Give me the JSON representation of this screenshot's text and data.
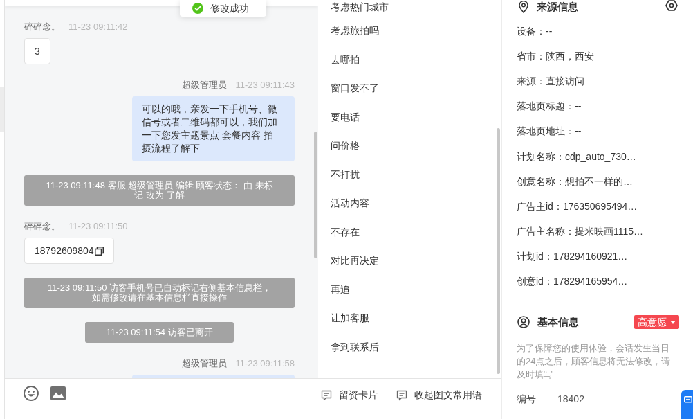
{
  "toast": {
    "kind": "success",
    "text": "修改成功"
  },
  "chat": {
    "messages": [
      {
        "kind": "visitor",
        "sender": "碎碎念。",
        "time": "11-23 09:11:42",
        "text": "3",
        "copyable": false
      },
      {
        "kind": "agent",
        "sender": "超级管理员",
        "time": "11-23 09:11:43",
        "text": "可以的哦，亲发一下手机号、微信号或者二维码都可以，我们加一下您发主题景点 套餐内容 拍摄流程了解下"
      },
      {
        "kind": "system",
        "text": "11-23 09:11:48 客服 超级管理员 编辑 顾客状态： 由 未标记 改为 了解"
      },
      {
        "kind": "visitor",
        "sender": "碎碎念。",
        "time": "11-23 09:11:50",
        "text": "18792609804",
        "copyable": true
      },
      {
        "kind": "system",
        "text": "11-23 09:11:50 访客手机号已自动标记右侧基本信息栏，如需修改请在基本信息栏直接操作"
      },
      {
        "kind": "system",
        "text": "11-23 09:11:54 访客已离开"
      },
      {
        "kind": "agent",
        "sender": "超级管理员",
        "time": "11-23 09:11:58"
      }
    ]
  },
  "input_toolbar": {
    "actions": [
      {
        "label": "留资卡片"
      },
      {
        "label": "收起图文常用语"
      }
    ]
  },
  "quick_replies": {
    "items": [
      "考虑热门城市",
      "考虑旅拍吗",
      "去哪拍",
      "窗口发不了",
      "要电话",
      "问价格",
      "不打扰",
      "活动内容",
      "不存在",
      "对比再决定",
      "再追",
      "让加客服",
      "拿到联系后"
    ]
  },
  "source_info": {
    "title": "来源信息",
    "fields": [
      "设备：--",
      "省市：陕西，西安",
      "来源：直接访问",
      "落地页标题：--",
      "落地页地址：--",
      "计划名称：cdp_auto_730…",
      "创意名称：想拍不一样的…",
      "广告主id：176350695494…",
      "广告主名称：提米映画1115…",
      "计划id：178294160921…",
      "创意id：178294165954…"
    ]
  },
  "basic_info": {
    "title": "基本信息",
    "intent_tag": "高意愿",
    "notice": "为了保障您的使用体验，会话发生当日的24点之后，顾客信息将无法修改，请及时填写",
    "fields": [
      {
        "label": "编号",
        "value": "18402"
      }
    ]
  }
}
